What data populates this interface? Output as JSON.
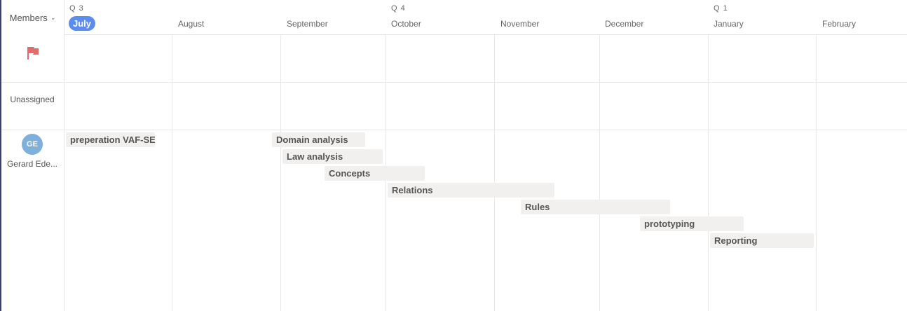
{
  "sidebar": {
    "members_label": "Members",
    "unassigned_label": "Unassigned",
    "member": {
      "initials": "GE",
      "name": "Gerard Ede..."
    }
  },
  "timeline": {
    "quarters": [
      "Q 3",
      "Q 4",
      "Q 1"
    ],
    "months": [
      "July",
      "August",
      "September",
      "October",
      "November",
      "December",
      "January",
      "February"
    ],
    "current_month": "July"
  },
  "tasks": [
    {
      "label": "preperation VAF-SE"
    },
    {
      "label": "Domain analysis"
    },
    {
      "label": "Law analysis"
    },
    {
      "label": "Concepts"
    },
    {
      "label": "Relations"
    },
    {
      "label": "Rules"
    },
    {
      "label": "prototyping"
    },
    {
      "label": "Reporting"
    }
  ],
  "colors": {
    "accent": "#5b8def",
    "flag": "#e36b6b",
    "avatar": "#7fb0dc",
    "bar": "#f1f0ee"
  }
}
